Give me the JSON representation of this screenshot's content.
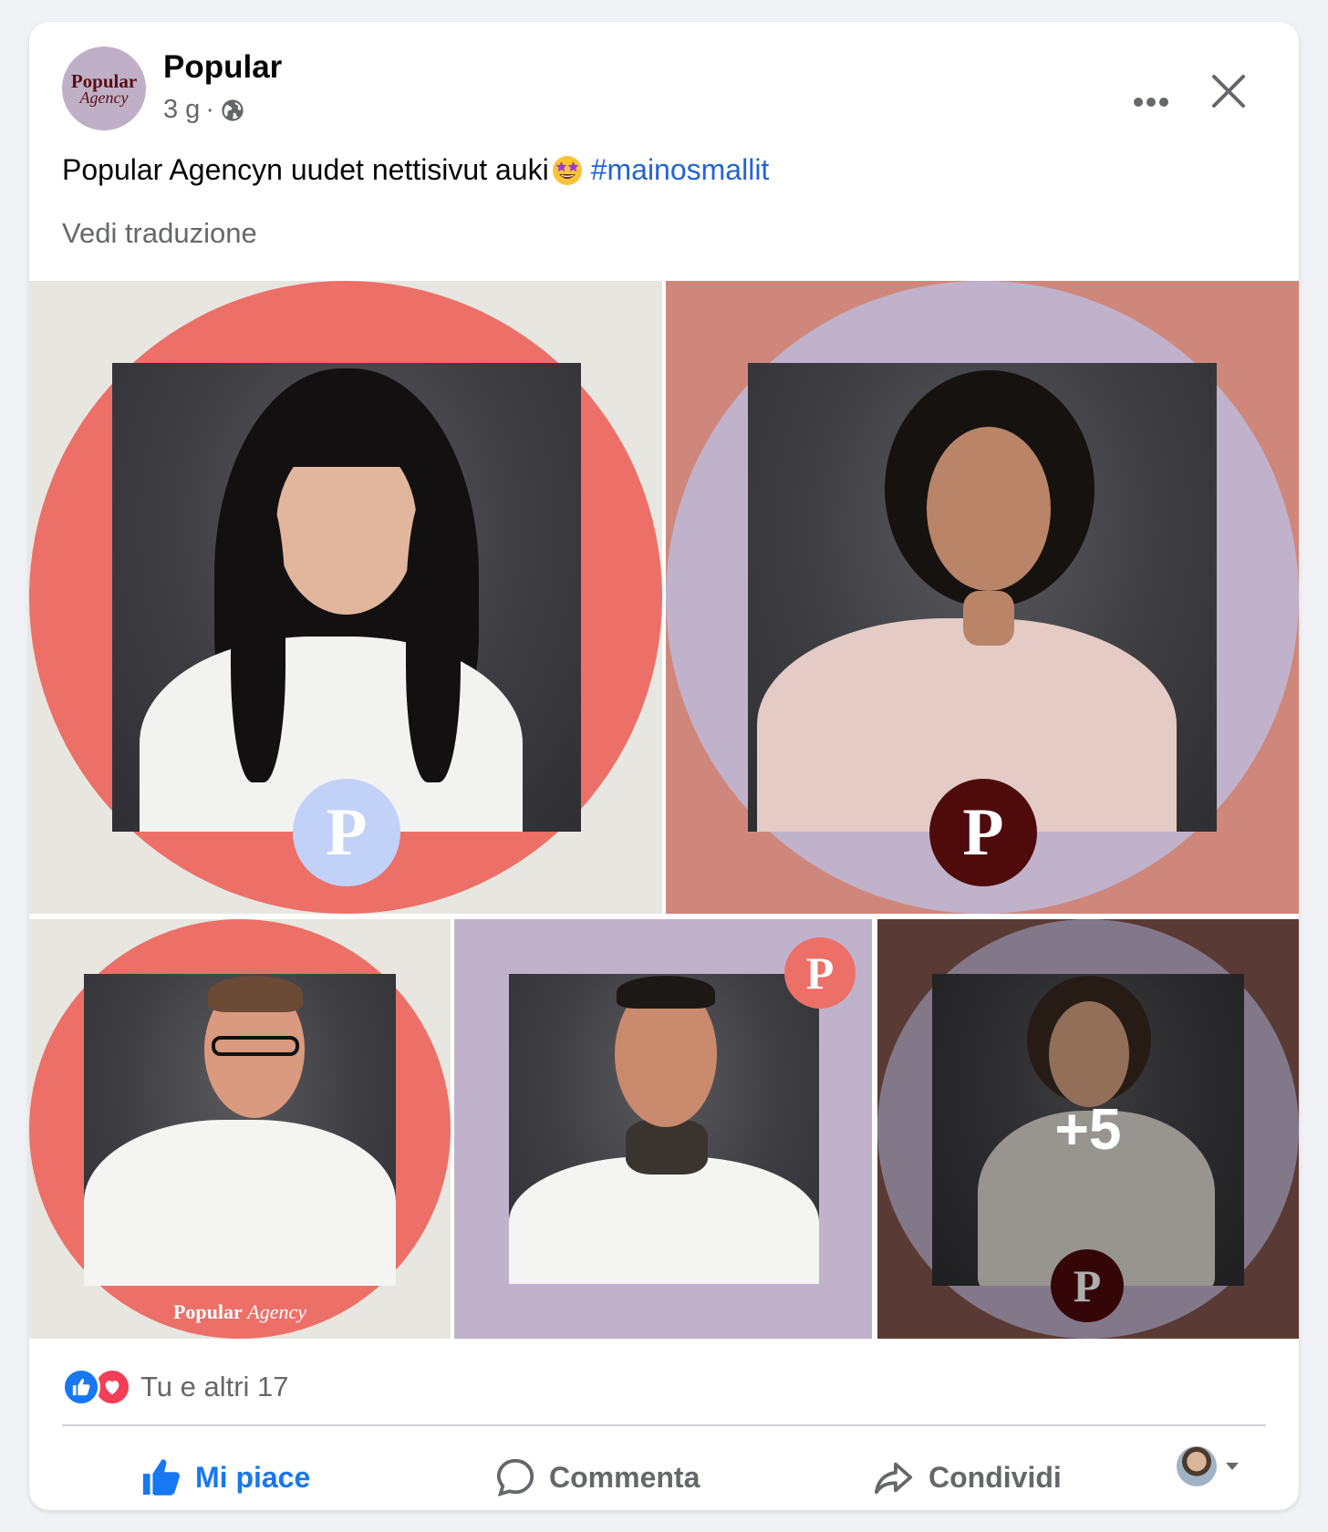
{
  "post": {
    "page_name": "Popular",
    "avatar_line1": "Popular",
    "avatar_line2": "Agency",
    "time": "3 g",
    "separator": "·",
    "audience_icon": "globe-icon",
    "text": "Popular Agencyn uudet nettisivut auki",
    "emoji": "star-struck-emoji",
    "hashtag": "#mainosmallit",
    "see_translation": "Vedi traduzione"
  },
  "gallery": {
    "badge_letter": "P",
    "watermark_bold": "Popular",
    "watermark_italic": "Agency",
    "more_count": "+5",
    "colors": {
      "coral": "#ec7068",
      "lavender": "#c1b2cb",
      "cream": "#e8e6e1",
      "terracotta": "#cf877b",
      "maroon": "#4f0a0b",
      "brown": "#85564f",
      "periwinkle": "#c2d1f8"
    }
  },
  "footer": {
    "reactions_text": "Tu e altri 17",
    "like_label": "Mi piace",
    "comment_label": "Commenta",
    "share_label": "Condividi"
  },
  "colors": {
    "link_blue": "#2364d3",
    "like_blue": "#1877f2",
    "love_red": "#f33e58",
    "secondary_text": "#65676b"
  }
}
